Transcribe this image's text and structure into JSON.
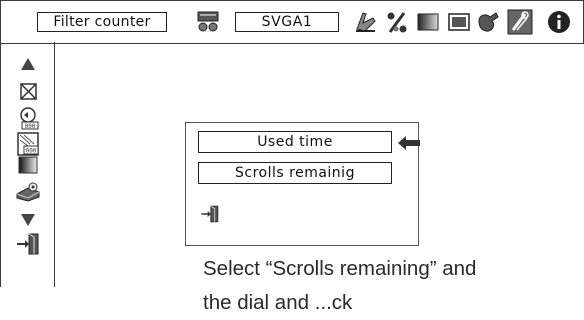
{
  "menubar": {
    "title": "Filter counter",
    "source": "SVGA1",
    "icons": [
      "input-icon",
      "pc-adjust-icon",
      "image-select-icon",
      "image-adjust-icon",
      "screen-icon",
      "sound-icon",
      "setting-icon",
      "information-icon"
    ]
  },
  "sidebar": {
    "icons": [
      "scroll-up-icon",
      "filter-warning-off-icon",
      "filter-reset-icon",
      "filter-counter-icon",
      "filter-gradient-icon",
      "projector-icon",
      "scroll-down-icon",
      "exit-icon"
    ]
  },
  "dialog": {
    "option_used": "Used time",
    "option_scrolls": "Scrolls remainig",
    "exit_icon": "exit-icon",
    "pointer_icon": "left-arrow-icon"
  },
  "caption": {
    "line1": "Select “Scrolls remaining” and",
    "line2": "the dial and ...ck"
  }
}
